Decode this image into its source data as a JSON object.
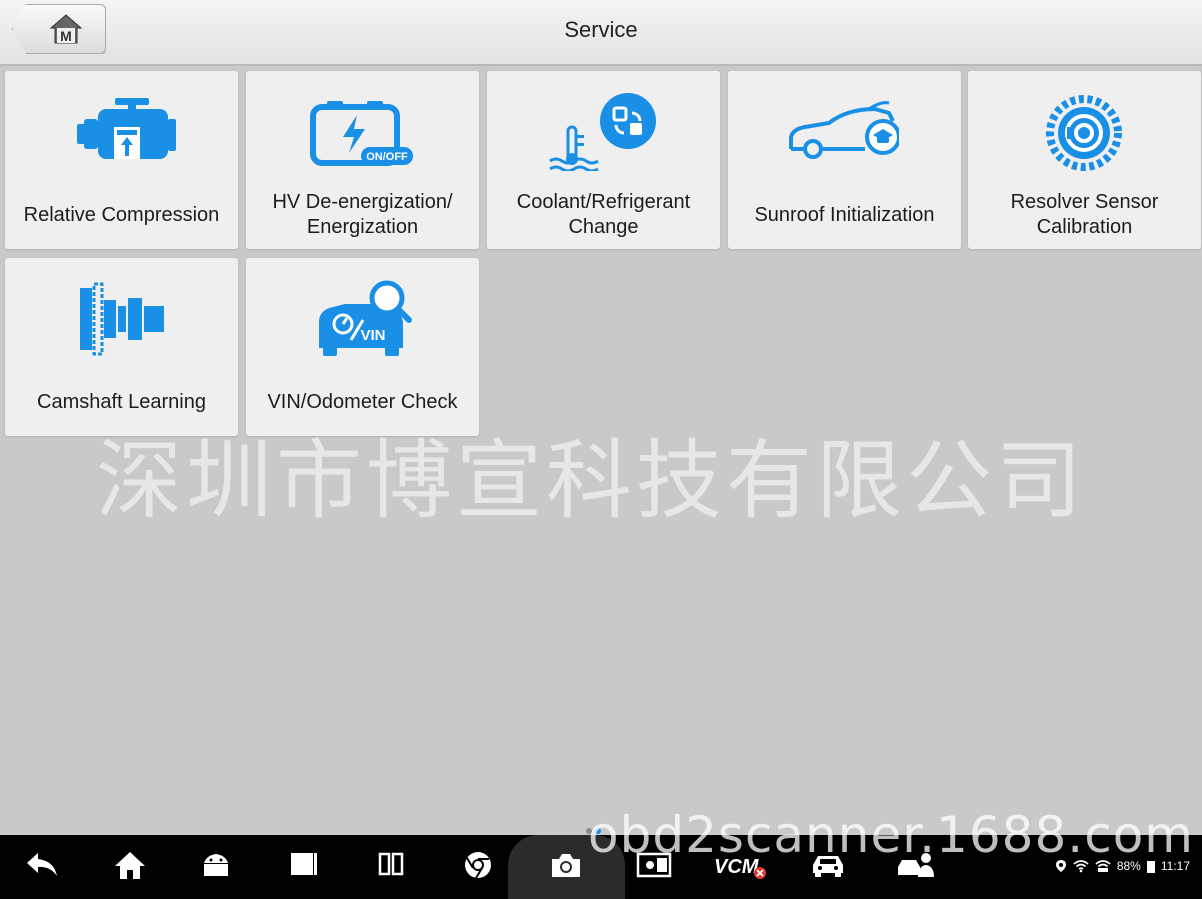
{
  "header": {
    "title": "Service",
    "home_letter": "M"
  },
  "tiles": [
    {
      "label": "Relative Compression",
      "icon": "engine-icon"
    },
    {
      "label": "HV De-energization/\nEnergization",
      "icon": "battery-onoff-icon",
      "badge": "ON/OFF"
    },
    {
      "label": "Coolant/Refrigerant\nChange",
      "icon": "coolant-icon"
    },
    {
      "label": "Sunroof Initialization",
      "icon": "car-sunroof-icon"
    },
    {
      "label": "Resolver Sensor\nCalibration",
      "icon": "resolver-gear-icon"
    },
    {
      "label": "Camshaft Learning",
      "icon": "camshaft-icon"
    },
    {
      "label": "VIN/Odometer Check",
      "icon": "vin-check-icon",
      "badge": "VIN"
    }
  ],
  "watermarks": {
    "company": "深圳市博宣科技有限公司",
    "site": "obd2scanner.1688.com"
  },
  "taskbar": {
    "items": [
      "back-icon",
      "home-icon",
      "android-icon",
      "window-icon",
      "split-icon",
      "chrome-icon",
      "camera-icon",
      "display-icon",
      "vci-icon",
      "car-icon",
      "car-person-icon"
    ],
    "vci_label": "VCM",
    "battery": "88%",
    "time": "11:17"
  },
  "colors": {
    "accent": "#1a8fe6",
    "tile": "#efefef",
    "background": "#c9c9c9"
  }
}
